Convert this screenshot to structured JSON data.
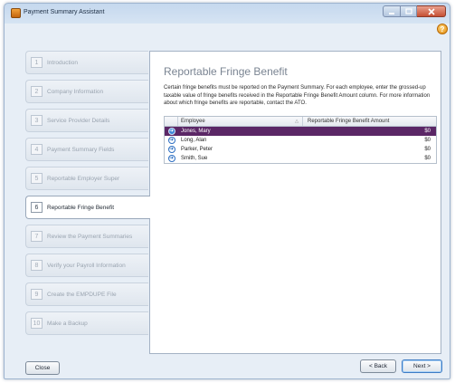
{
  "window": {
    "title": "Payment Summary Assistant"
  },
  "help": {
    "glyph": "?"
  },
  "steps": [
    {
      "num": "1",
      "label": "Introduction"
    },
    {
      "num": "2",
      "label": "Company Information"
    },
    {
      "num": "3",
      "label": "Service Provider Details"
    },
    {
      "num": "4",
      "label": "Payment Summary Fields"
    },
    {
      "num": "5",
      "label": "Reportable Employer Super"
    },
    {
      "num": "6",
      "label": "Reportable Fringe Benefit"
    },
    {
      "num": "7",
      "label": "Review the Payment Summaries"
    },
    {
      "num": "8",
      "label": "Verify your Payroll Information"
    },
    {
      "num": "9",
      "label": "Create the EMPDUPE File"
    },
    {
      "num": "10",
      "label": "Make a Backup"
    }
  ],
  "active_step": 5,
  "panel": {
    "title": "Reportable Fringe Benefit",
    "description": "Certain fringe benefits must be reported on the Payment Summary. For each employee, enter the grossed-up taxable value of fringe benefits received in the Reportable Fringe Benefit Amount column. For more information about which fringe benefits are reportable, contact the ATO."
  },
  "grid": {
    "col_employee": "Employee",
    "col_amount": "Reportable Fringe Benefit Amount",
    "rows": [
      {
        "employee": "Jones, Mary",
        "amount": "$0"
      },
      {
        "employee": "Long, Alan",
        "amount": "$0"
      },
      {
        "employee": "Parker, Peter",
        "amount": "$0"
      },
      {
        "employee": "Smith, Sue",
        "amount": "$0"
      }
    ]
  },
  "buttons": {
    "close": "Close",
    "back": "< Back",
    "next": "Next >"
  },
  "colors": {
    "selected_row": "#5b2766",
    "accent": "#3b86d8"
  }
}
